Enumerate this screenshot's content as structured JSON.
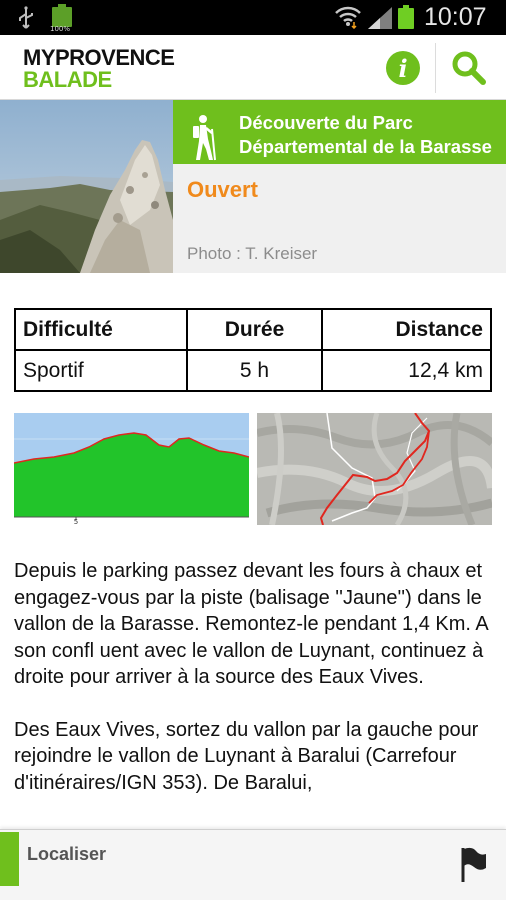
{
  "status_bar": {
    "battery_percent": "100%",
    "time": "10:07",
    "icons": [
      "usb-icon",
      "battery-full-icon",
      "wifi-icon",
      "signal-icon",
      "battery-icon"
    ]
  },
  "header": {
    "logo_line1": "MYPROVENCE",
    "logo_line2": "BALADE",
    "info_icon": "info-icon",
    "search_icon": "search-icon"
  },
  "hero": {
    "title_line1": "Découverte du Parc",
    "title_line2": "Départemental de la Barasse",
    "status": "Ouvert",
    "photo_credit": "Photo : T. Kreiser",
    "icon": "hiker-icon"
  },
  "info_table": {
    "headers": [
      "Difficulté",
      "Durée",
      "Distance"
    ],
    "row": [
      "Sportif",
      "5 h",
      "12,4 km"
    ]
  },
  "profile": {
    "axis_tick": "5"
  },
  "description": {
    "paragraphs": [
      "Depuis le parking passez devant les fours à chaux et engagez-vous par la piste (balisage ''Jaune'') dans le vallon de la Barasse. Remontez-le pendant 1,4 Km. A son confl uent avec le vallon de Luynant, continuez à droite pour arriver à la source des Eaux Vives.",
      "Des Eaux Vives, sortez du vallon par la gauche pour rejoindre le vallon de Luynant à Baralui (Carrefour d'itinéraires/IGN 353). De Baralui,"
    ]
  },
  "bottom_bar": {
    "label": "Localiser",
    "icon": "flag-icon"
  },
  "colors": {
    "brand_green": "#6fbf1d",
    "status_orange": "#f08a1c",
    "profile_fill": "#22c42a",
    "profile_line": "#e0271f",
    "credit_gray": "#8c8c8c"
  }
}
